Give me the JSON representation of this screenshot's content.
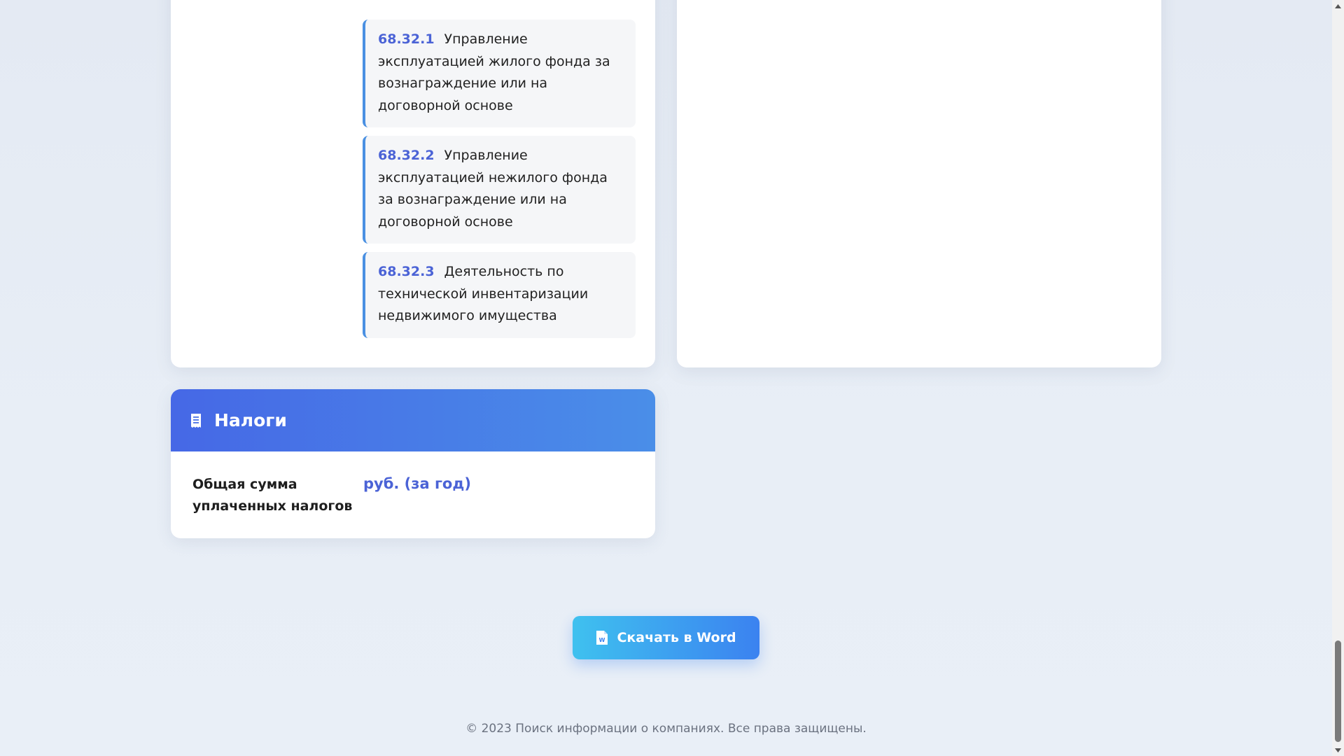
{
  "activities": {
    "items": [
      {
        "code": "68.32.1",
        "text": "Управление эксплуатацией жилого фонда за вознаграждение или на договорной основе"
      },
      {
        "code": "68.32.2",
        "text": "Управление эксплуатацией нежилого фонда за вознаграждение или на договорной основе"
      },
      {
        "code": "68.32.3",
        "text": "Деятельность по технической инвентаризации недвижимого имущества"
      }
    ]
  },
  "taxes": {
    "title": "Налоги",
    "icon": "receipt-icon",
    "total_label": "Общая сумма уплаченных налогов",
    "total_value": "руб. (за год)"
  },
  "download": {
    "label": "Скачать в Word",
    "icon": "word-file-icon"
  },
  "footer": {
    "text": "© 2023 Поиск информации о компаниях. Все права защищены."
  },
  "colors": {
    "accent": "#4b63d6",
    "header_gradient_start": "#4668e6",
    "header_gradient_end": "#4a8ee8",
    "button_gradient_start": "#3fc1ef",
    "button_gradient_end": "#3b82f0",
    "item_border": "#4a90e2"
  }
}
